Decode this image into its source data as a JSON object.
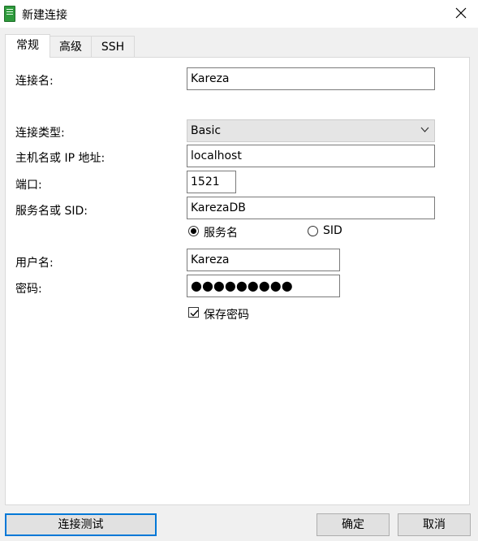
{
  "window": {
    "title": "新建连接",
    "icon": "database-icon",
    "close_symbol": "✕"
  },
  "tabs": [
    {
      "label": "常规",
      "active": true
    },
    {
      "label": "高级",
      "active": false
    },
    {
      "label": "SSH",
      "active": false
    }
  ],
  "form": {
    "connection_name": {
      "label": "连接名:",
      "value": "Kareza"
    },
    "connection_type": {
      "label": "连接类型:",
      "value": "Basic"
    },
    "host": {
      "label": "主机名或 IP 地址:",
      "value": "localhost"
    },
    "port": {
      "label": "端口:",
      "value": "1521"
    },
    "service": {
      "label": "服务名或 SID:",
      "value": "KarezaDB"
    },
    "service_mode": {
      "options": [
        "服务名",
        "SID"
      ],
      "selected": "服务名"
    },
    "username": {
      "label": "用户名:",
      "value": "Kareza"
    },
    "password": {
      "label": "密码:",
      "value": "●●●●●●●●●"
    },
    "save_password": {
      "label": "保存密码",
      "checked": true
    }
  },
  "buttons": {
    "test": "连接测试",
    "ok": "确定",
    "cancel": "取消"
  },
  "colors": {
    "accent": "#0078d7",
    "dialog_bg": "#f0f0f0",
    "icon_green": "#2e9a3c"
  }
}
